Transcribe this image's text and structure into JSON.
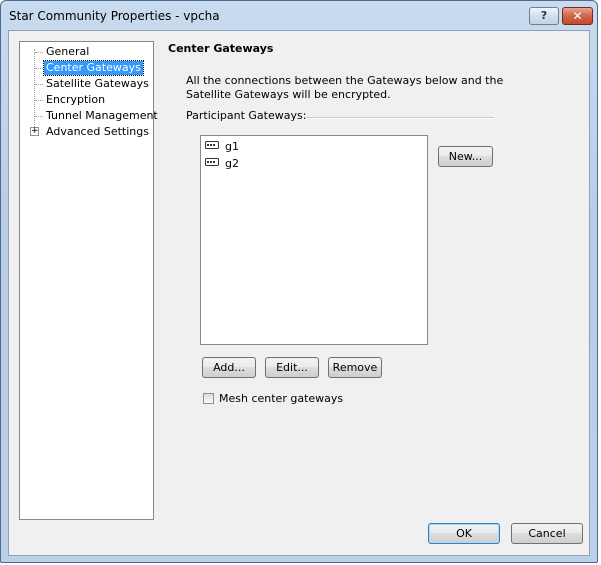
{
  "window": {
    "title": "Star Community Properties - vpcha",
    "help_label": "?",
    "close_label": "✕"
  },
  "tree": {
    "items": [
      {
        "label": "General"
      },
      {
        "label": "Center Gateways"
      },
      {
        "label": "Satellite Gateways"
      },
      {
        "label": "Encryption"
      },
      {
        "label": "Tunnel Management"
      },
      {
        "label": "Advanced Settings",
        "expander": "+"
      }
    ],
    "selected": "Center Gateways"
  },
  "panel": {
    "title": "Center Gateways",
    "description": "All the connections between the Gateways below and the Satellite Gateways will be encrypted.",
    "participants_label": "Participant Gateways:",
    "gateways": [
      {
        "name": "g1",
        "icon": "gateway-icon"
      },
      {
        "name": "g2",
        "icon": "gateway-icon"
      }
    ],
    "new_label": "New...",
    "add_label": "Add...",
    "edit_label": "Edit...",
    "remove_label": "Remove",
    "mesh_label": "Mesh center gateways",
    "mesh_checked": false
  },
  "footer": {
    "ok_label": "OK",
    "cancel_label": "Cancel"
  },
  "colors": {
    "selection": "#3399ff",
    "titlebar": "#b8cde6",
    "close_button": "#c34a30"
  }
}
